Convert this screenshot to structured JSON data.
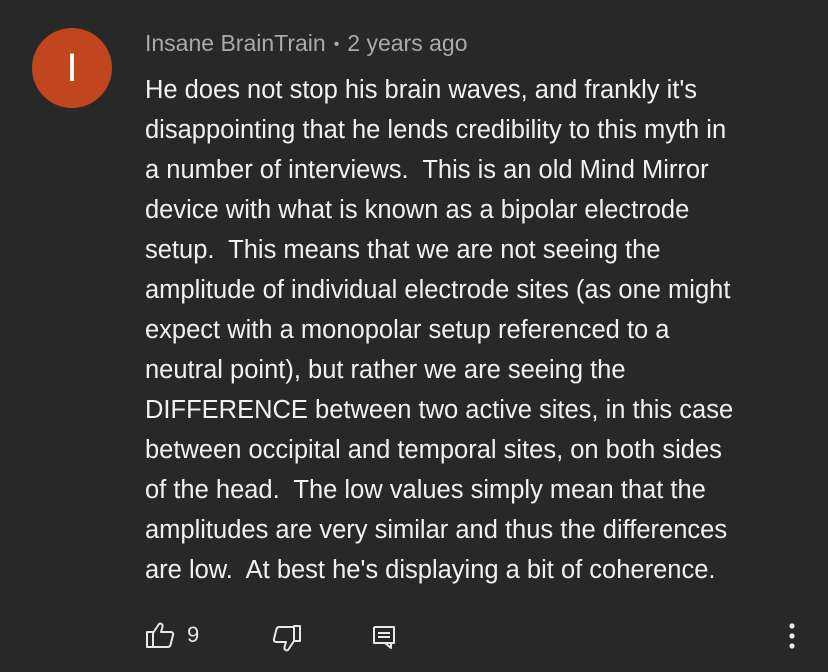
{
  "comment": {
    "avatar_letter": "I",
    "avatar_color": "#c1461f",
    "author": "Insane BrainTrain",
    "separator": "•",
    "timestamp": "2 years ago",
    "text": "He does not stop his brain waves, and frankly it's\ndisappointing that he lends credibility to this myth in\na number of interviews.  This is an old Mind Mirror\ndevice with what is known as a bipolar electrode\nsetup.  This means that we are not seeing the\namplitude of individual electrode sites (as one might\nexpect with a monopolar setup referenced to a\nneutral point), but rather we are seeing the\nDIFFERENCE between two active sites, in this case\nbetween occipital and temporal sites, on both sides\nof the head.  The low values simply mean that the\namplitudes are very similar and thus the differences\nare low.  At best he's displaying a bit of coherence."
  },
  "actions": {
    "like_count": "9",
    "like_icon": "thumbs-up-icon",
    "dislike_icon": "thumbs-down-icon",
    "reply_icon": "reply-icon",
    "more_icon": "more-vertical-icon"
  }
}
